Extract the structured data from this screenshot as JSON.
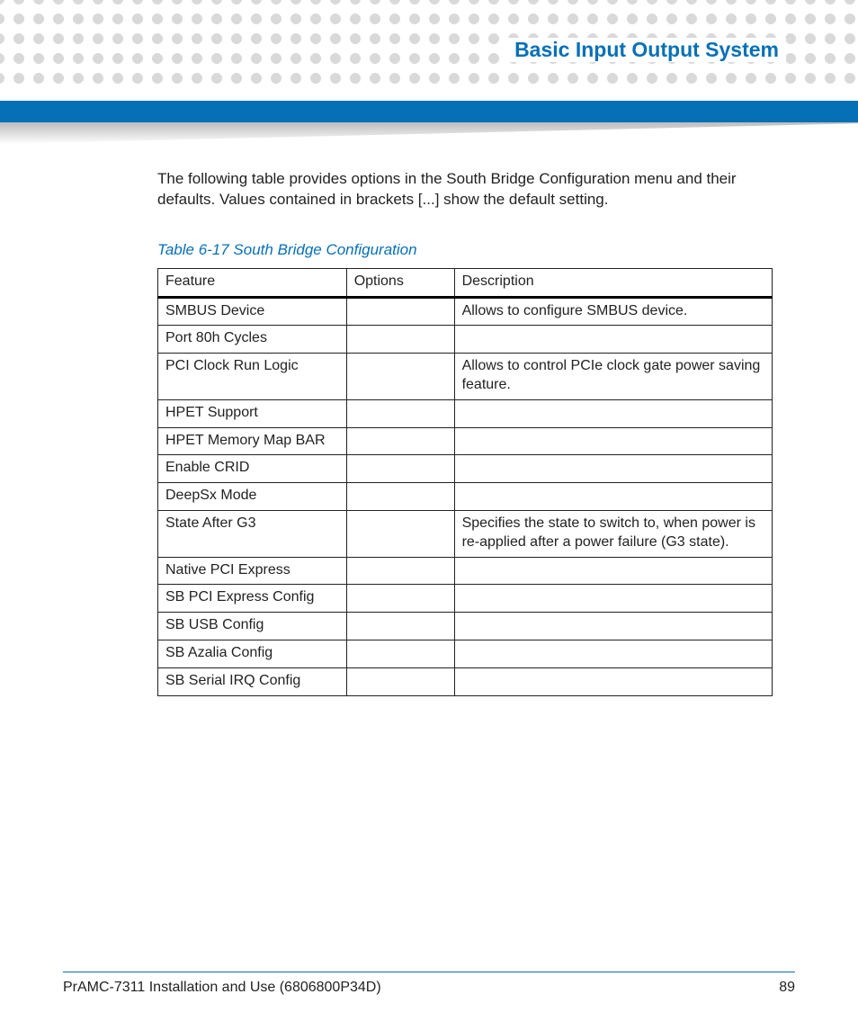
{
  "header": {
    "section_title": "Basic Input Output System"
  },
  "body": {
    "intro": "The following table provides options in the South Bridge Configuration menu and their defaults. Values contained in brackets [...] show the default setting.",
    "table_caption": "Table 6-17 South Bridge Configuration",
    "columns": {
      "feature": "Feature",
      "options": "Options",
      "description": "Description"
    },
    "rows": [
      {
        "feature": "SMBUS Device",
        "options": "",
        "description": "Allows to configure SMBUS device."
      },
      {
        "feature": "Port 80h Cycles",
        "options": "",
        "description": ""
      },
      {
        "feature": "PCI Clock Run Logic",
        "options": "",
        "description": "Allows to control PCIe clock gate power saving feature."
      },
      {
        "feature": "HPET Support",
        "options": "",
        "description": ""
      },
      {
        "feature": "HPET Memory Map BAR",
        "options": "",
        "description": ""
      },
      {
        "feature": "Enable CRID",
        "options": "",
        "description": ""
      },
      {
        "feature": "DeepSx Mode",
        "options": "",
        "description": ""
      },
      {
        "feature": "State After G3",
        "options": "",
        "description": "Specifies the state to switch to, when power is re-applied after a power failure (G3 state)."
      },
      {
        "feature": "Native PCI Express",
        "options": "",
        "description": ""
      },
      {
        "feature": "SB PCI Express Config",
        "options": "",
        "description": ""
      },
      {
        "feature": "SB USB Config",
        "options": "",
        "description": ""
      },
      {
        "feature": "SB Azalia Config",
        "options": "",
        "description": ""
      },
      {
        "feature": "SB Serial IRQ Config",
        "options": "",
        "description": ""
      }
    ]
  },
  "footer": {
    "doc_id": "PrAMC-7311 Installation and Use (6806800P34D)",
    "page": "89"
  }
}
